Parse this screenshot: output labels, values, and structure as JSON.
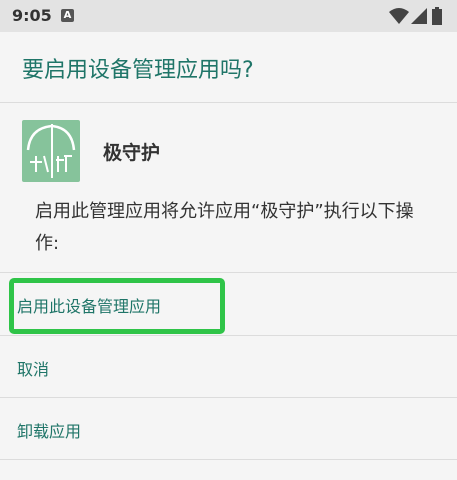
{
  "status_bar": {
    "time": "9:05",
    "notification_letter": "A",
    "icons": [
      "wifi-icon",
      "signal-icon",
      "battery-icon"
    ]
  },
  "dialog": {
    "title": "要启用设备管理应用吗?",
    "app_name": "极守护",
    "description": "启用此管理应用将允许应用“极守护”执行以下操作:",
    "actions": {
      "activate": "启用此设备管理应用",
      "cancel": "取消",
      "uninstall": "卸载应用"
    }
  },
  "colors": {
    "accent": "#1f7568",
    "highlight": "#2fc448",
    "app_icon_bg": "#86c39b"
  }
}
